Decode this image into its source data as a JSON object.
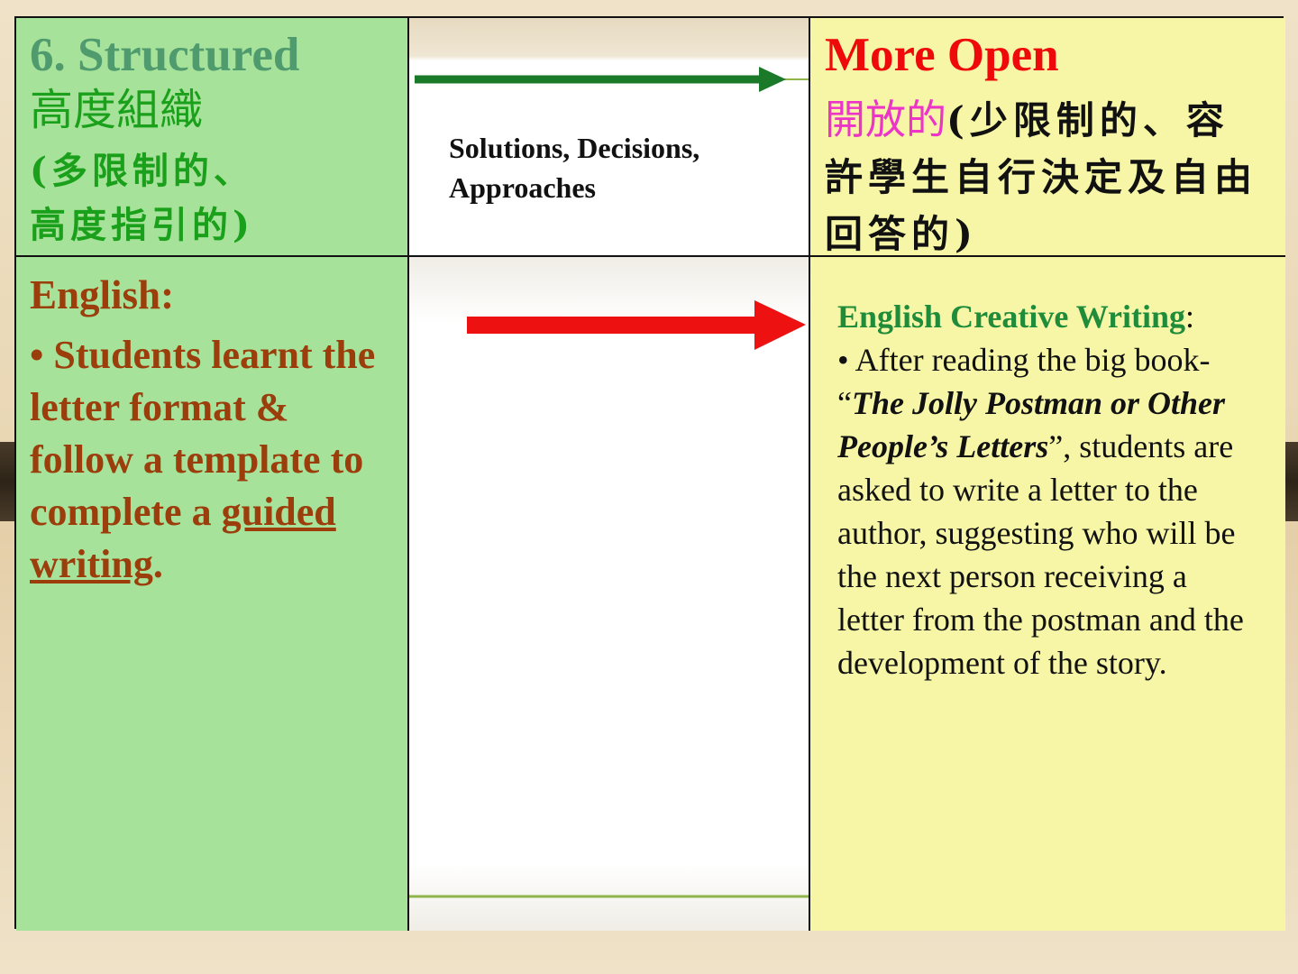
{
  "top_left": {
    "title": "6. Structured",
    "zh_line1": "高度組織",
    "zh_line2": "(多限制的、",
    "zh_line3": "高度指引的)"
  },
  "top_middle": {
    "line1": "Solutions, Decisions,",
    "line2": "Approaches"
  },
  "top_right": {
    "title": "More Open",
    "zh_pink": "開放的",
    "zh_black": "(少限制的、容許學生自行決定及自由回答的)"
  },
  "bottom_left": {
    "heading": "English:",
    "bullet": "• Students learnt the letter format & follow a template to complete a ",
    "underlined_1": "guided",
    "underlined_2": "writing",
    "end": "."
  },
  "bottom_right": {
    "heading": "English Creative Writing",
    "colon": ":",
    "bullet_start": "•  After reading the big book- “",
    "book_title": "The Jolly Postman or Other People’s Letters",
    "bullet_end": "”, students are asked to write a letter to the author, suggesting who will be the next person receiving a letter from the postman and the development of the story."
  },
  "colors": {
    "left_bg": "#a6e29a",
    "right_bg": "#f6f6a6",
    "top_arrow": "#1a7a2a",
    "bottom_arrow": "#ee1111",
    "title_red": "#ee0a0a",
    "title_green": "#4f9b6e",
    "body_brown": "#9b3e0c",
    "pink": "#ec34c9"
  }
}
